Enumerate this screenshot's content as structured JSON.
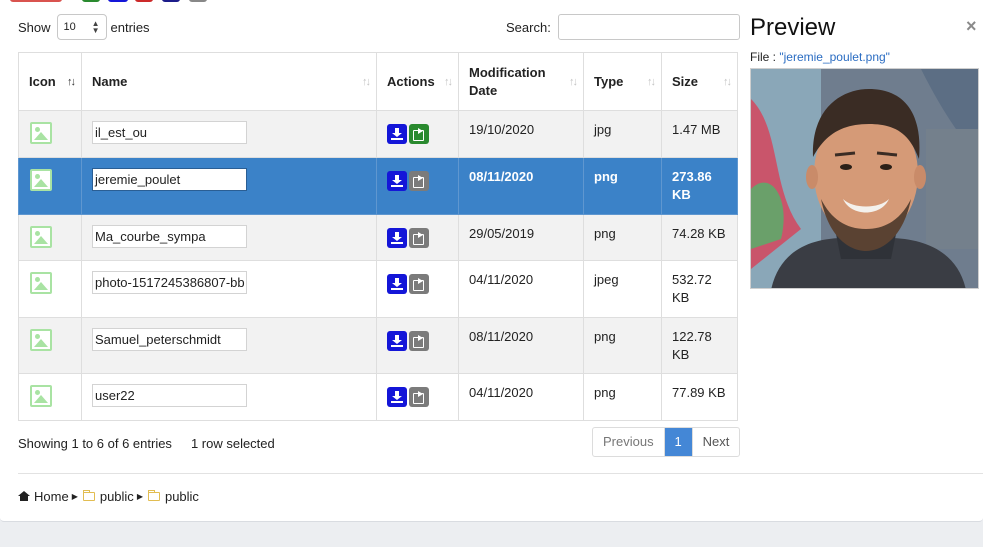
{
  "table_controls": {
    "show_label": "Show",
    "entries_value": "10",
    "entries_label": "entries",
    "search_label": "Search:",
    "search_value": ""
  },
  "columns": [
    "Icon",
    "Name",
    "Actions",
    "Modification Date",
    "Type",
    "Size"
  ],
  "rows": [
    {
      "name": "il_est_ou",
      "date": "19/10/2020",
      "type": "jpg",
      "size": "1.47 MB",
      "selected": false
    },
    {
      "name": "jeremie_poulet",
      "date": "08/11/2020",
      "type": "png",
      "size": "273.86 KB",
      "selected": true
    },
    {
      "name": "Ma_courbe_sympa",
      "date": "29/05/2019",
      "type": "png",
      "size": "74.28 KB",
      "selected": false
    },
    {
      "name": "photo-1517245386807-bb",
      "date": "04/11/2020",
      "type": "jpeg",
      "size": "532.72 KB",
      "selected": false
    },
    {
      "name": "Samuel_peterschmidt",
      "date": "08/11/2020",
      "type": "png",
      "size": "122.78 KB",
      "selected": false
    },
    {
      "name": "user22",
      "date": "04/11/2020",
      "type": "png",
      "size": "77.89 KB",
      "selected": false
    }
  ],
  "footer": {
    "info": "Showing 1 to 6 of 6 entries",
    "selection": "1 row selected"
  },
  "pagination": {
    "previous": "Previous",
    "current": "1",
    "next": "Next"
  },
  "breadcrumb": {
    "home": "Home",
    "folder1": "public",
    "folder2": "public"
  },
  "preview": {
    "title": "Preview",
    "file_prefix": "File : ",
    "file_name": "\"jeremie_poulet.png\"",
    "close_glyph": "×"
  },
  "colors": {
    "selected_row": "#3b82c8",
    "download_button": "#1416d8",
    "share_button_active": "#2a8a2f",
    "share_button_inactive": "#7b7b7b",
    "pagination_active": "#4487d6",
    "link": "#2a6cc2"
  }
}
